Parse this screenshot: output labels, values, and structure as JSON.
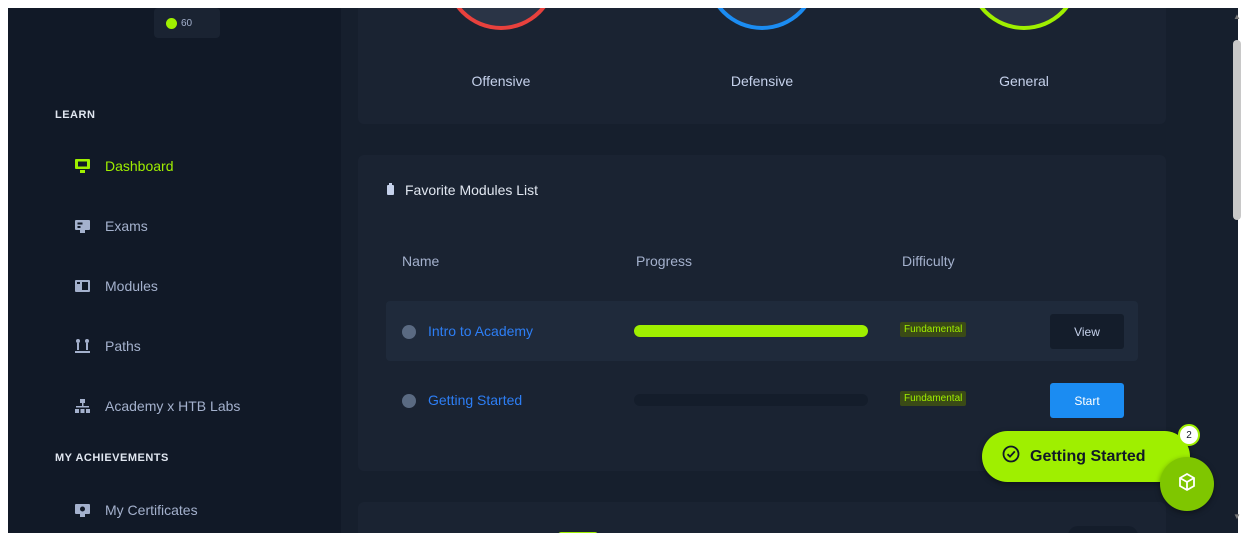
{
  "sidebar": {
    "coins": "60",
    "learn_title": "LEARN",
    "learn_items": [
      {
        "label": "Dashboard",
        "icon": "monitor-icon",
        "active": true
      },
      {
        "label": "Exams",
        "icon": "exam-icon",
        "active": false
      },
      {
        "label": "Modules",
        "icon": "modules-icon",
        "active": false
      },
      {
        "label": "Paths",
        "icon": "paths-icon",
        "active": false
      },
      {
        "label": "Academy x HTB Labs",
        "icon": "network-icon",
        "active": false
      }
    ],
    "achievements_title": "MY ACHIEVEMENTS",
    "achievement_items": [
      {
        "label": "My Certificates",
        "icon": "certificate-icon"
      }
    ]
  },
  "categories": [
    {
      "label": "Offensive",
      "color": "#e8413d"
    },
    {
      "label": "Defensive",
      "color": "#1b8cf2"
    },
    {
      "label": "General",
      "color": "#9fef00"
    }
  ],
  "favorites": {
    "title": "Favorite Modules List",
    "columns": {
      "name": "Name",
      "progress": "Progress",
      "difficulty": "Difficulty"
    },
    "rows": [
      {
        "name": "Intro to Academy",
        "progress": 1.0,
        "difficulty": "Fundamental",
        "action": "View"
      },
      {
        "name": "Getting Started",
        "progress": 0.0,
        "difficulty": "Fundamental",
        "action": "Start"
      }
    ]
  },
  "getting_started": {
    "label": "Getting Started",
    "count": "2"
  },
  "colors": {
    "accent": "#9fef00",
    "link": "#2d7ef5",
    "start_button": "#1b8cf2"
  }
}
